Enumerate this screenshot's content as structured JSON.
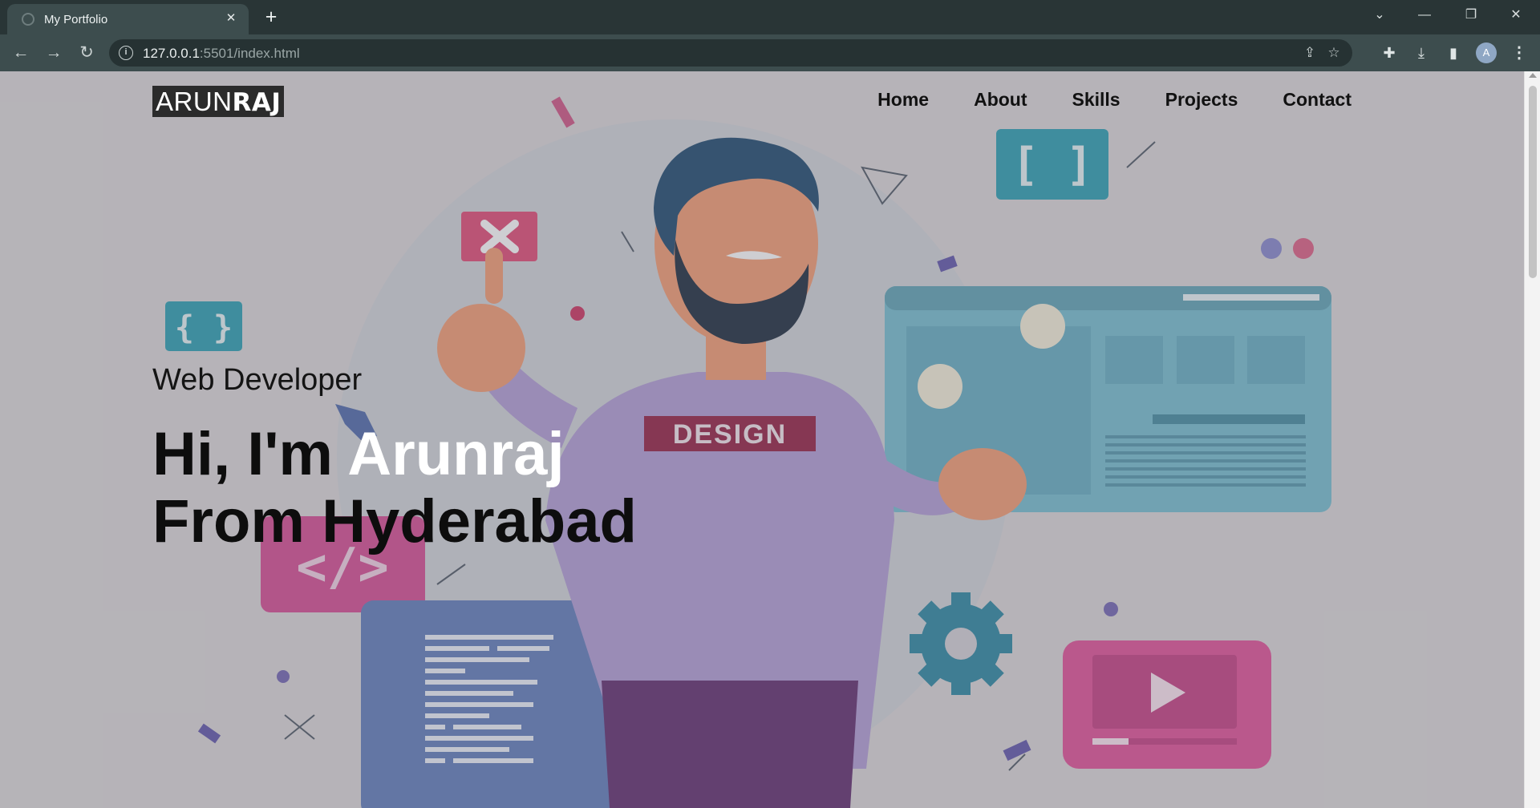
{
  "browser": {
    "tab_title": "My Portfolio",
    "url_host": "127.0.0.1",
    "url_rest": ":5501/index.html"
  },
  "page": {
    "logo_first": "ARUN",
    "logo_second": "RAJ",
    "nav": [
      "Home",
      "About",
      "Skills",
      "Projects",
      "Contact"
    ],
    "subtitle": "Web Developer",
    "headline_prefix": "Hi, I'm ",
    "headline_name": "Arunraj",
    "headline_line2": "From Hyderabad",
    "shirt_text": "DESIGN"
  }
}
